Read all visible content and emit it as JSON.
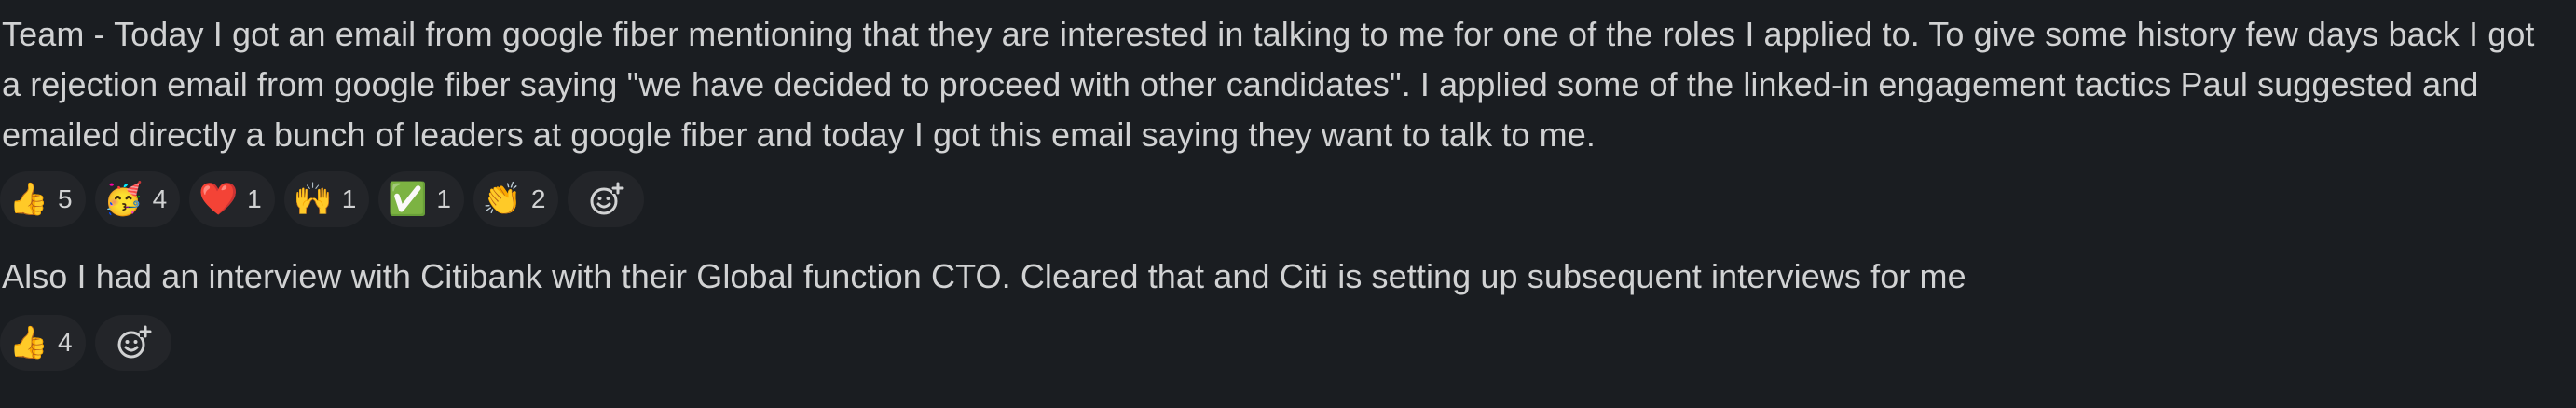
{
  "messages": [
    {
      "text": "Team - Today I got an email from google fiber mentioning that they are interested in talking to me for one of the roles I applied to. To give some history few days back I got a rejection email from google fiber saying \"we have decided to proceed with other candidates\". I applied some of the linked-in engagement tactics Paul suggested and emailed directly a bunch of leaders at google fiber and today I got this email saying they want to talk to me.",
      "reactions": [
        {
          "icon": "thumbs-up-icon",
          "emoji": "👍",
          "count": "5"
        },
        {
          "icon": "party-face-icon",
          "emoji": "🥳",
          "count": "4"
        },
        {
          "icon": "red-heart-icon",
          "emoji": "❤️",
          "count": "1"
        },
        {
          "icon": "raised-hands-icon",
          "emoji": "🙌",
          "count": "1"
        },
        {
          "icon": "check-mark-icon",
          "emoji": "✅",
          "count": "1"
        },
        {
          "icon": "clapping-hands-icon",
          "emoji": "👏",
          "count": "2"
        }
      ]
    },
    {
      "text": "Also I had an interview with Citibank with their Global function CTO. Cleared that and Citi is setting up subsequent interviews for me",
      "reactions": [
        {
          "icon": "thumbs-up-icon",
          "emoji": "👍",
          "count": "4"
        }
      ]
    }
  ],
  "add_reaction_icon": "add-reaction-icon",
  "colors": {
    "background": "#1a1d21",
    "text": "#d1d2d3",
    "pill": "#232529"
  }
}
